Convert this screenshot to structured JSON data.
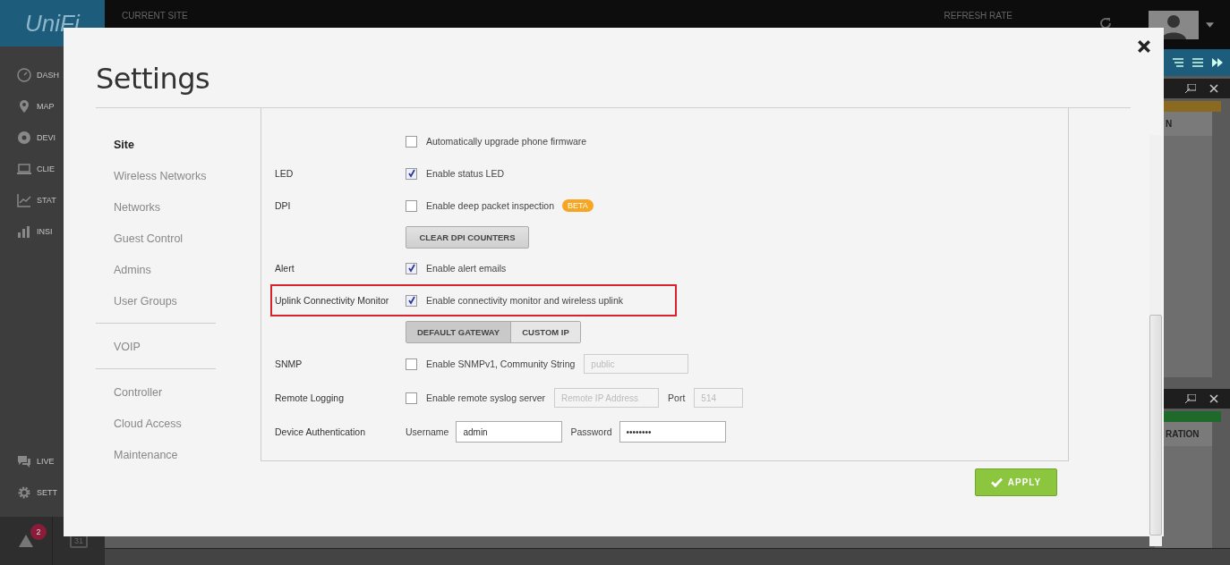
{
  "app": {
    "logo": "UniFi",
    "current_site_label": "CURRENT SITE",
    "refresh_rate_label": "REFRESH RATE",
    "nav": [
      {
        "label": "DASH",
        "kind": "dashboard"
      },
      {
        "label": "MAP",
        "kind": "map"
      },
      {
        "label": "DEVI",
        "kind": "devices"
      },
      {
        "label": "CLIE",
        "kind": "clients"
      },
      {
        "label": "STAT",
        "kind": "stats"
      },
      {
        "label": "INSI",
        "kind": "insights"
      }
    ],
    "bottom_nav": [
      {
        "label": "LIVE",
        "kind": "chat"
      },
      {
        "label": "SETT",
        "kind": "settings"
      }
    ],
    "alert_count": "2",
    "calendar_day": "31",
    "right_panel": {
      "tab_top": "N",
      "tab_bottom": "RATION"
    }
  },
  "dialog": {
    "title": "Settings",
    "nav_groups": [
      {
        "items": [
          {
            "label": "Site",
            "selected": true
          },
          {
            "label": "Wireless Networks",
            "selected": false
          },
          {
            "label": "Networks",
            "selected": false
          },
          {
            "label": "Guest Control",
            "selected": false
          },
          {
            "label": "Admins",
            "selected": false
          },
          {
            "label": "User Groups",
            "selected": false
          }
        ]
      },
      {
        "items": [
          {
            "label": "VOIP",
            "selected": false
          }
        ]
      },
      {
        "items": [
          {
            "label": "Controller",
            "selected": false
          },
          {
            "label": "Cloud Access",
            "selected": false
          },
          {
            "label": "Maintenance",
            "selected": false
          }
        ]
      }
    ],
    "rows": [
      {
        "kind": "checkbox",
        "text": "Automatically upgrade phone firmware",
        "checked": false
      },
      {
        "kind": "checkbox",
        "label": "LED",
        "text": "Enable status LED",
        "checked": true
      },
      {
        "kind": "checkbox",
        "label": "DPI",
        "text": "Enable deep packet inspection",
        "badge": "BETA",
        "checked": false
      },
      {
        "kind": "button",
        "text": "CLEAR DPI COUNTERS"
      },
      {
        "kind": "checkbox",
        "label": "Alert",
        "text": "Enable alert emails",
        "checked": true
      },
      {
        "kind": "checkbox",
        "label": "Uplink Connectivity Monitor",
        "text": "Enable connectivity monitor and wireless uplink",
        "checked": true,
        "highlighted": true
      },
      {
        "kind": "segmented",
        "options": [
          {
            "label": "DEFAULT GATEWAY",
            "selected": true
          },
          {
            "label": "CUSTOM IP",
            "selected": false
          }
        ]
      },
      {
        "kind": "checkbox_fields",
        "label": "SNMP",
        "text": "Enable SNMPv1, Community String",
        "checked": false,
        "fields": [
          {
            "placeholder": "public"
          }
        ]
      },
      {
        "kind": "checkbox_fields",
        "label": "Remote Logging",
        "text": "Enable remote syslog server",
        "checked": false,
        "fields": [
          {
            "placeholder": "Remote IP Address"
          },
          {
            "label": "Port",
            "placeholder": "514"
          }
        ]
      },
      {
        "kind": "credentials",
        "label": "Device Authentication",
        "fields": [
          {
            "label": "Username",
            "value": "admin"
          },
          {
            "label": "Password",
            "value": "••••••••"
          }
        ]
      }
    ],
    "apply": "APPLY"
  }
}
